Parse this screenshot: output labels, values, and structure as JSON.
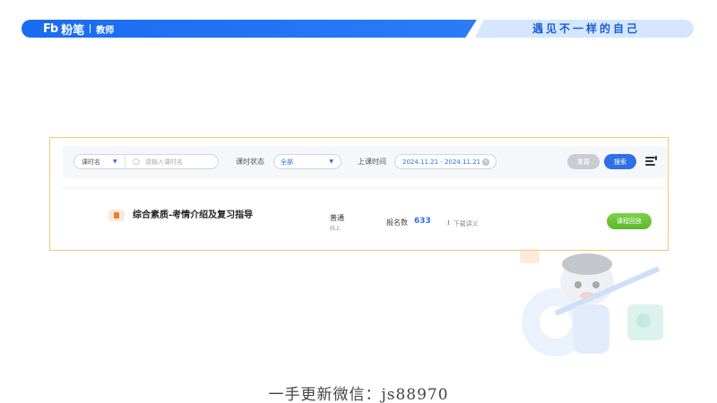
{
  "banner": {
    "logo_mark": "Fb",
    "brand": "粉笔",
    "role": "教师",
    "slogan": "遇见不一样的自己",
    "left_color": "#1a6bf0",
    "right_color": "#d5e6fd"
  },
  "filters": {
    "field_select": "课时名",
    "search_placeholder": "请输入课时名",
    "status_label": "课时状态",
    "status_value": "全部",
    "time_label": "上课时间",
    "date_range": "2024.11.21 - 2024.11.21",
    "reset_label": "重置",
    "search_label": "搜索",
    "icons": [
      "chevron-down-icon",
      "search-icon",
      "clear-icon",
      "menu-icon"
    ]
  },
  "course": {
    "title": "综合素质-考情介绍及复习指导",
    "type": "普通",
    "mode": "线上",
    "enroll_label": "报名数",
    "enroll_count": "633",
    "download_label": "下载讲义",
    "replay_label": "课程回放",
    "accent_colors": {
      "primary": "#2f6fe8",
      "replay": "#5ab82c",
      "course_icon": "#f07b2d",
      "frame": "#f3c875"
    }
  },
  "watermark": "一手更新微信：js88970"
}
